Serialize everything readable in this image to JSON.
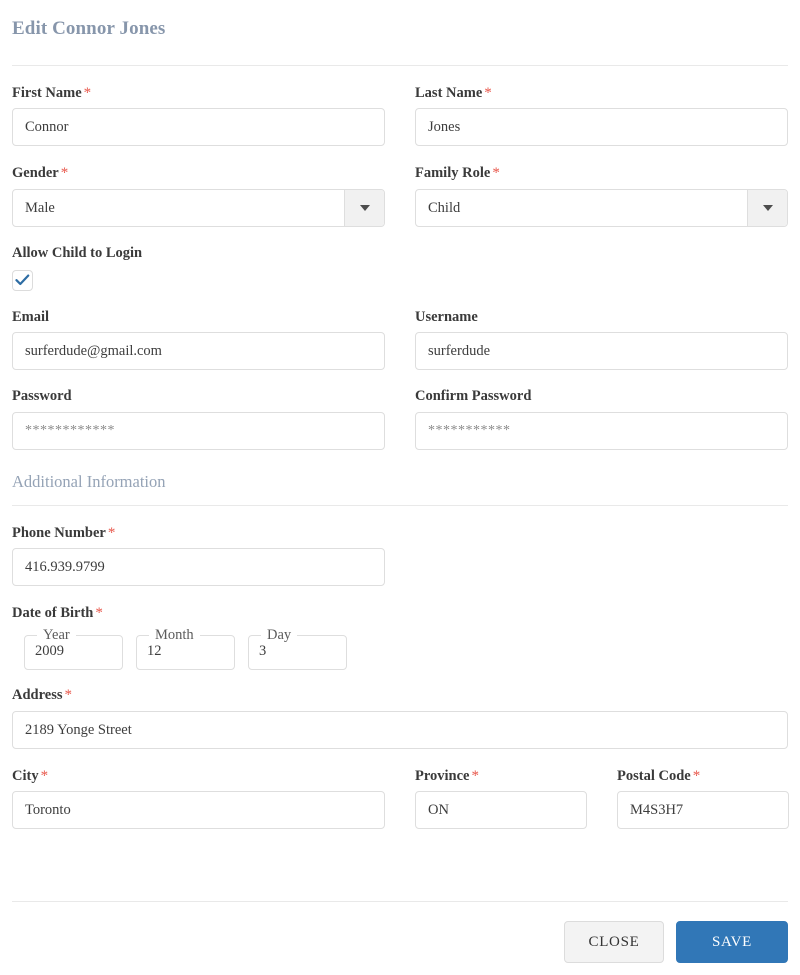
{
  "form": {
    "title": "Edit Connor Jones",
    "section_header": "Additional Information",
    "required_mark": "*"
  },
  "fields": {
    "first_name": {
      "label": "First Name",
      "value": "Connor"
    },
    "last_name": {
      "label": "Last Name",
      "value": "Jones"
    },
    "gender": {
      "label": "Gender",
      "value": "Male"
    },
    "family_role": {
      "label": "Family Role",
      "value": "Child"
    },
    "allow_login": {
      "label": "Allow Child to Login",
      "checked": true
    },
    "email": {
      "label": "Email",
      "value": "surferdude@gmail.com"
    },
    "username": {
      "label": "Username",
      "value": "surferdude"
    },
    "password": {
      "label": "Password",
      "value": "************"
    },
    "confirm_password": {
      "label": "Confirm Password",
      "value": "***********"
    },
    "phone": {
      "label": "Phone Number",
      "value": "416.939.9799"
    },
    "dob": {
      "label": "Date of Birth",
      "year_label": "Year",
      "year_value": "2009",
      "month_label": "Month",
      "month_value": "12",
      "day_label": "Day",
      "day_value": "3"
    },
    "address": {
      "label": "Address",
      "value": "2189 Yonge Street"
    },
    "city": {
      "label": "City",
      "value": "Toronto"
    },
    "province": {
      "label": "Province",
      "value": "ON"
    },
    "postal_code": {
      "label": "Postal Code",
      "value": "M4S3H7"
    }
  },
  "footer": {
    "close_label": "CLOSE",
    "save_label": "SAVE"
  },
  "colors": {
    "title": "#8796ab",
    "required": "#e8564a",
    "save_button": "#3177b7",
    "check": "#2e6da4",
    "border": "#dedede"
  }
}
